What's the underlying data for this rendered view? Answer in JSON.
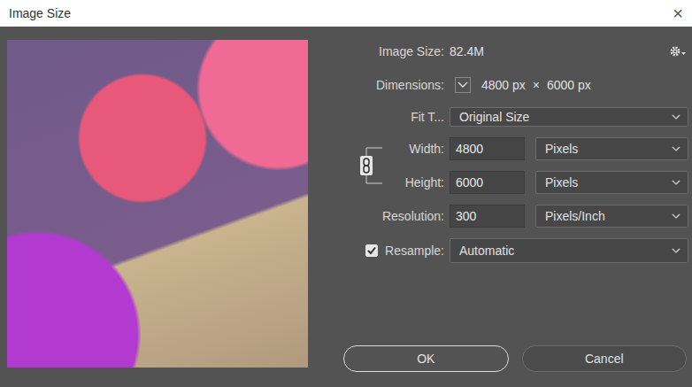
{
  "window": {
    "title": "Image Size",
    "close": "×"
  },
  "image_size": {
    "label": "Image Size:",
    "value": "82.4M"
  },
  "dimensions": {
    "label": "Dimensions:",
    "width": "4800 px",
    "separator": "×",
    "height": "6000 px",
    "expanded": false
  },
  "fit_to": {
    "label": "Fit T...",
    "value": "Original Size"
  },
  "fields": [
    {
      "label": "Width:",
      "value": "4800",
      "unit": "Pixels",
      "linked": true
    },
    {
      "label": "Height:",
      "value": "6000",
      "unit": "Pixels",
      "linked": true
    },
    {
      "label": "Resolution:",
      "value": "300",
      "unit": "Pixels/Inch",
      "linked": false
    }
  ],
  "constrain_proportions": {
    "linked": true
  },
  "resample": {
    "label": "Resample:",
    "checked": true,
    "value": "Automatic"
  },
  "buttons": [
    {
      "label": "OK",
      "default": true
    },
    {
      "label": "Cancel",
      "default": false
    }
  ]
}
